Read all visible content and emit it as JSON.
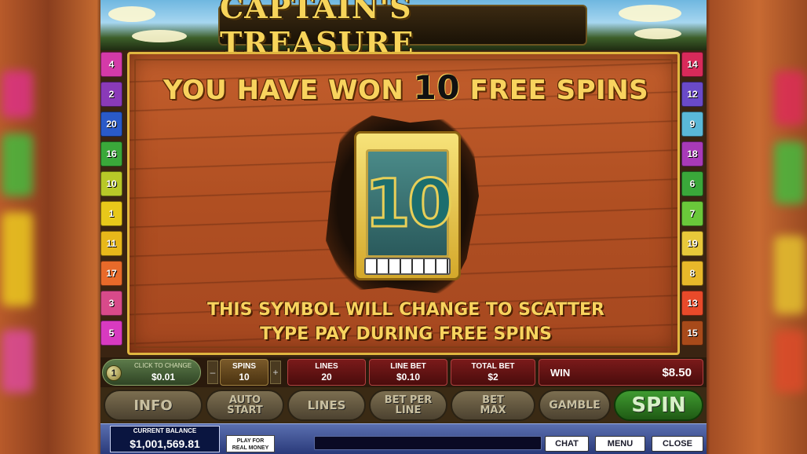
{
  "game": {
    "title": "CAPTAIN'S TREASURE",
    "won_prefix": "YOU HAVE WON",
    "won_count": "10",
    "won_suffix": "FREE SPINS",
    "symbol_number": "10",
    "description_line1": "THIS SYMBOL WILL CHANGE TO SCATTER",
    "description_line2": "TYPE PAY DURING FREE SPINS"
  },
  "lines_left": [
    {
      "label": "4",
      "color": "#d43aa8"
    },
    {
      "label": "2",
      "color": "#8a3ab8"
    },
    {
      "label": "20",
      "color": "#2a5ac8"
    },
    {
      "label": "16",
      "color": "#3aa83a"
    },
    {
      "label": "10",
      "color": "#b8c828"
    },
    {
      "label": "1",
      "color": "#e8c81a"
    },
    {
      "label": "11",
      "color": "#e8b81a"
    },
    {
      "label": "17",
      "color": "#e86a2a"
    },
    {
      "label": "3",
      "color": "#d84a8a"
    },
    {
      "label": "5",
      "color": "#d83ac0"
    }
  ],
  "lines_right": [
    {
      "label": "14",
      "color": "#d82a5a"
    },
    {
      "label": "12",
      "color": "#6a4ac8"
    },
    {
      "label": "9",
      "color": "#5ab8d8"
    },
    {
      "label": "18",
      "color": "#a83ab8"
    },
    {
      "label": "6",
      "color": "#3aa83a"
    },
    {
      "label": "7",
      "color": "#6ac83a"
    },
    {
      "label": "19",
      "color": "#e8c83a"
    },
    {
      "label": "8",
      "color": "#e8b82a"
    },
    {
      "label": "13",
      "color": "#e84a2a"
    },
    {
      "label": "15",
      "color": "#a84a1a"
    }
  ],
  "info": {
    "coin_icon_label": "1",
    "coin_label": "CLICK TO CHANGE",
    "coin_value": "$0.01",
    "spins_label": "SPINS",
    "spins_value": "10",
    "spins_minus": "–",
    "spins_plus": "+",
    "lines_label": "LINES",
    "lines_value": "20",
    "line_bet_label": "LINE BET",
    "line_bet_value": "$0.10",
    "total_bet_label": "TOTAL BET",
    "total_bet_value": "$2",
    "win_label": "WIN",
    "win_value": "$8.50"
  },
  "buttons": {
    "info": "INFO",
    "auto_start_1": "AUTO",
    "auto_start_2": "START",
    "lines": "LINES",
    "bet_per_line_1": "BET PER",
    "bet_per_line_2": "LINE",
    "bet_max_1": "BET",
    "bet_max_2": "MAX",
    "gamble": "GAMBLE",
    "spin": "SPIN"
  },
  "bottom": {
    "balance_label": "CURRENT BALANCE",
    "balance_value": "$1,001,569.81",
    "real_money_1": "PLAY FOR",
    "real_money_2": "REAL MONEY",
    "chat": "CHAT",
    "menu": "MENU",
    "close": "CLOSE"
  }
}
